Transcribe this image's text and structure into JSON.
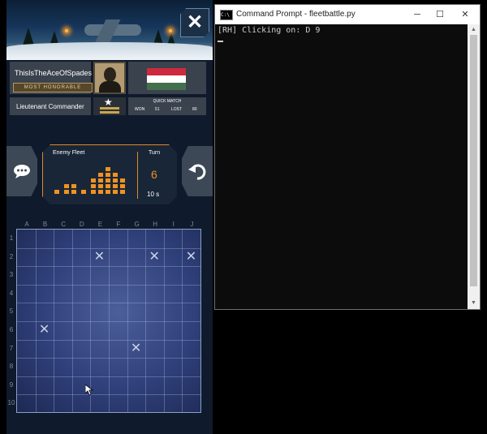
{
  "game": {
    "close_icon": "close-icon",
    "player": {
      "name": "ThisIsTheAceOfSpades",
      "title": "MOST HONORABLE",
      "rank": "Lieutenant Commander",
      "flag_colors": [
        "#cd2a3e",
        "#ffffff",
        "#436f4d"
      ]
    },
    "quick_match": {
      "title": "QUICK MATCH",
      "won_label": "WON",
      "won": "51",
      "lost_label": "LOST",
      "lost": "80"
    },
    "chat_icon": "speech-bubble-icon",
    "undo_icon": "undo-arrow-icon",
    "fleet": {
      "title": "Enemy Fleet",
      "turn_label": "Turn",
      "turn_number": "6",
      "time_left": "10 s"
    },
    "board": {
      "columns": [
        "A",
        "B",
        "C",
        "D",
        "E",
        "F",
        "G",
        "H",
        "I",
        "J"
      ],
      "rows": [
        "1",
        "2",
        "3",
        "4",
        "5",
        "6",
        "7",
        "8",
        "9",
        "10"
      ],
      "misses": [
        {
          "cell": "E2",
          "mark": "✕"
        },
        {
          "cell": "H2",
          "mark": "✕"
        },
        {
          "cell": "J2",
          "mark": "✕"
        },
        {
          "cell": "B6",
          "mark": "✕"
        },
        {
          "cell": "G7",
          "mark": "✕"
        }
      ]
    }
  },
  "console": {
    "title": "Command Prompt - fleetbattle.py",
    "icon": "cmd-icon",
    "icon_text": "C:\\",
    "minimize": "─",
    "maximize": "☐",
    "close": "✕",
    "output_line": "[RH] Clicking on: D 9"
  }
}
